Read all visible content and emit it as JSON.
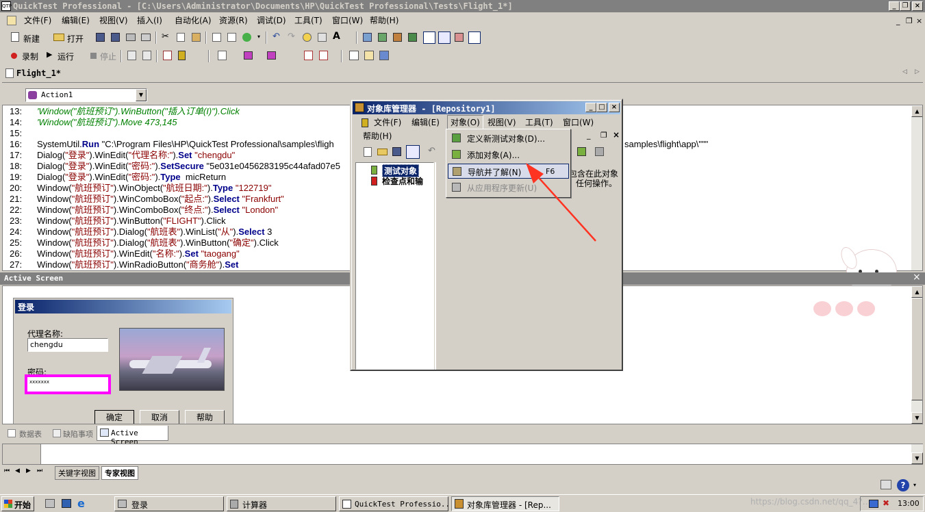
{
  "title_bar": {
    "title": "QuickTest Professional - [C:\\Users\\Administrator\\Documents\\HP\\QuickTest Professional\\Tests\\Flight_1*]"
  },
  "menu": [
    "文件(F)",
    "编辑(E)",
    "视图(V)",
    "插入(I)",
    "自动化(A)",
    "资源(R)",
    "调试(D)",
    "工具(T)",
    "窗口(W)",
    "帮助(H)"
  ],
  "toolbar1": {
    "new": "新建",
    "open": "打开"
  },
  "toolbar2": {
    "record": "录制",
    "run": "运行",
    "stop": "停止"
  },
  "doc_tab": "Flight_1*",
  "action_select": "Action1",
  "code_lines": [
    {
      "n": "13:",
      "t": "'Window(\"航班预订\").WinButton(\"插入订单(I)\").Click",
      "cls": "c"
    },
    {
      "n": "14:",
      "t": "'Window(\"航班预订\").Move 473,145",
      "cls": "c"
    },
    {
      "n": "15:",
      "t": "",
      "cls": ""
    },
    {
      "n": "16:",
      "t": "SystemUtil.Run \"C:\\Program Files\\HP\\QuickTest Professional\\samples\\fligh",
      "cls": ""
    },
    {
      "n": "17:",
      "t": "Dialog(\"登录\").WinEdit(\"代理名称:\").Set \"chengdu\"",
      "cls": ""
    },
    {
      "n": "18:",
      "t": "Dialog(\"登录\").WinEdit(\"密码:\").SetSecure \"5e031e0456283195c44afad07e5",
      "cls": ""
    },
    {
      "n": "19:",
      "t": "Dialog(\"登录\").WinEdit(\"密码:\").Type  micReturn",
      "cls": ""
    },
    {
      "n": "20:",
      "t": "Window(\"航班预订\").WinObject(\"航班日期:\").Type \"122719\"",
      "cls": ""
    },
    {
      "n": "21:",
      "t": "Window(\"航班预订\").WinComboBox(\"起点:\").Select \"Frankfurt\"",
      "cls": ""
    },
    {
      "n": "22:",
      "t": "Window(\"航班预订\").WinComboBox(\"终点:\").Select \"London\"",
      "cls": ""
    },
    {
      "n": "23:",
      "t": "Window(\"航班预订\").WinButton(\"FLIGHT\").Click",
      "cls": ""
    },
    {
      "n": "24:",
      "t": "Window(\"航班预订\").Dialog(\"航班表\").WinList(\"从\").Select 3",
      "cls": ""
    },
    {
      "n": "25:",
      "t": "Window(\"航班预订\").Dialog(\"航班表\").WinButton(\"确定\").Click",
      "cls": ""
    },
    {
      "n": "26:",
      "t": "Window(\"航班预订\").WinEdit(\"名称:\").Set \"taogang\"",
      "cls": ""
    },
    {
      "n": "27:",
      "t": "Window(\"航班预订\").WinRadioButton(\"商务舱\").Set",
      "cls": ""
    }
  ],
  "code_right_fragment": "samples\\flight\\app\\\"\"\"",
  "active_screen": {
    "pane_title": "Active Screen",
    "login": {
      "title": "登录",
      "agent_label": "代理名称:",
      "agent_value": "chengdu",
      "password_label": "密码:",
      "password_value": "xxxxxxx",
      "ok": "确定",
      "cancel": "取消",
      "help": "帮助"
    }
  },
  "bottom_tabs": [
    "数据表",
    "缺陷事项",
    "Active Screen"
  ],
  "view_tabs": [
    "关键字视图",
    "专家视图"
  ],
  "repo": {
    "title": "对象库管理器 - [Repository1]",
    "menu": [
      "文件(F)",
      "编辑(E)",
      "对象(O)",
      "视图(V)",
      "工具(T)",
      "窗口(W)"
    ],
    "menu2": "帮助(H)",
    "tree": [
      "测试对象",
      "检查点和输"
    ],
    "right_text_1": "包含在此对象",
    "right_text_2": "任何操作。",
    "dropdown": [
      {
        "label": "定义新测试对象(D)...",
        "shortcut": "",
        "state": "normal"
      },
      {
        "label": "添加对象(A)...",
        "shortcut": "",
        "state": "normal"
      },
      {
        "label": "导航并了解(N)",
        "shortcut": "F6",
        "state": "highlight"
      },
      {
        "label": "从应用程序更新(U)",
        "shortcut": "",
        "state": "disabled"
      }
    ]
  },
  "taskbar": {
    "start": "开始",
    "tasks": [
      "登录",
      "计算器",
      "QuickTest Professio...",
      "对象库管理器 - [Rep..."
    ],
    "clock": "13:00",
    "watermark": "https://blog.csdn.net/qq_4?…"
  },
  "colors": {
    "title_active": "#0a246a",
    "highlight": "#0a246a",
    "password_outline": "#ff00ff",
    "arrow": "#ff3322"
  }
}
